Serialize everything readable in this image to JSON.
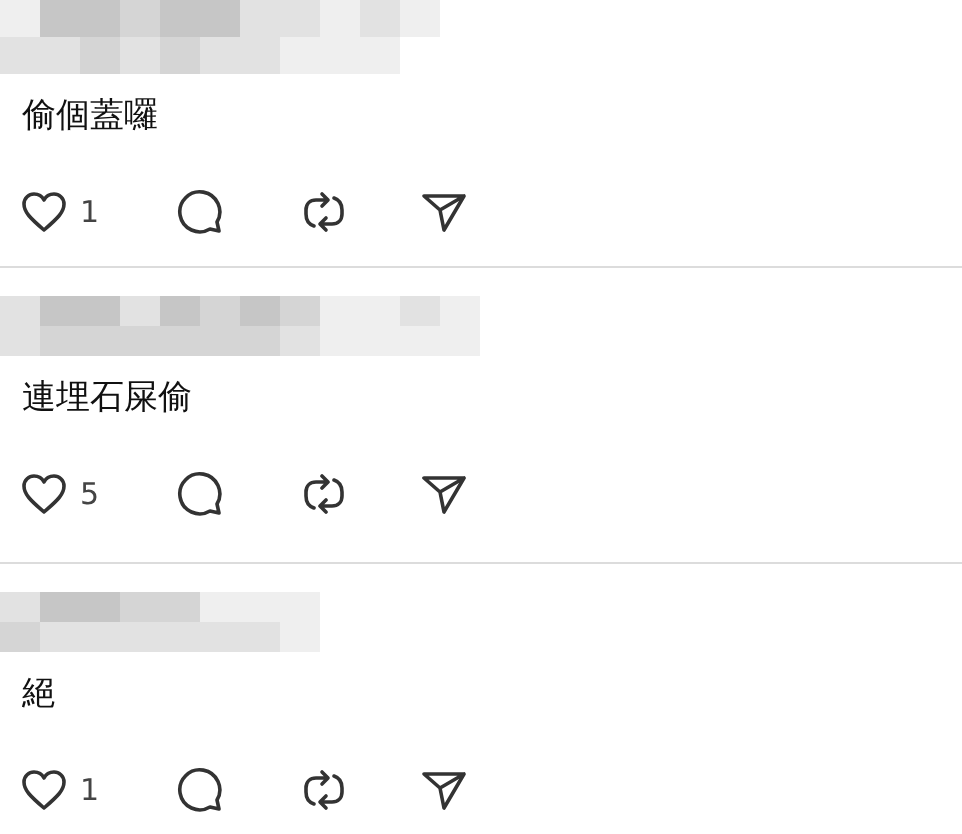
{
  "comments": [
    {
      "text": "偷個蓋囉",
      "likes": "1"
    },
    {
      "text": "連埋石屎偷",
      "likes": "5"
    },
    {
      "text": "絕",
      "likes": "1"
    }
  ]
}
